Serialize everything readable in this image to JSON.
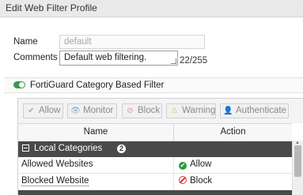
{
  "window": {
    "title": "Edit Web Filter Profile"
  },
  "form": {
    "name_label": "Name",
    "name_value": "default",
    "comments_label": "Comments",
    "comments_value": "Default web filtering.",
    "comments_counter": "22/255"
  },
  "section": {
    "title": "FortiGuard Category Based Filter",
    "enabled": true
  },
  "toolbar": {
    "buttons": [
      {
        "label": "Allow",
        "icon": "check-circle-icon"
      },
      {
        "label": "Monitor",
        "icon": "eye-icon"
      },
      {
        "label": "Block",
        "icon": "block-icon"
      },
      {
        "label": "Warning",
        "icon": "warning-icon"
      },
      {
        "label": "Authenticate",
        "icon": "user-icon"
      }
    ]
  },
  "table": {
    "columns": [
      "Name",
      "Action"
    ],
    "group": {
      "title": "Local Categories",
      "count": "2"
    },
    "rows": [
      {
        "name": "Allowed Websites",
        "action": "Allow"
      },
      {
        "name": "Blocked Website",
        "action": "Block"
      }
    ]
  },
  "colors": {
    "allow": "#2f9a41",
    "block": "#d63a3a",
    "toggle_on": "#3b9a4e",
    "group_header": "#4a4a4a"
  }
}
